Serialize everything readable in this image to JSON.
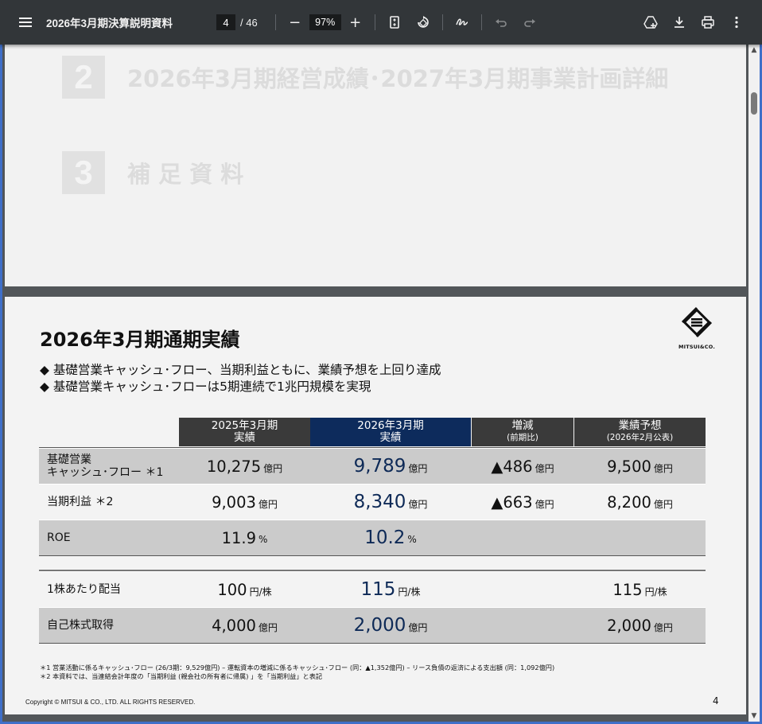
{
  "toolbar": {
    "menu_icon": "hamburger-menu-icon",
    "title": "2026年3月期決算説明資料",
    "current_page": "4",
    "total_pages": "/ 46",
    "zoom_out": "−",
    "zoom_value": "97%",
    "zoom_in": "+",
    "icons": [
      "fit-page-icon",
      "rotate-icon",
      "annotate-icon",
      "undo-icon",
      "redo-icon",
      "save-to-drive-icon",
      "download-icon",
      "print-icon",
      "more-vert-icon"
    ]
  },
  "page1": {
    "toc": [
      {
        "num": "2",
        "text": "2026年3月期経営成績･2027年3月期事業計画詳細"
      },
      {
        "num": "3",
        "text": "補 足 資 料"
      }
    ]
  },
  "page2": {
    "logo_text": "MITSUI&CO.",
    "title": "2026年3月期通期実績",
    "bullets": [
      "基礎営業キャッシュ･フロー、当期利益ともに、業績予想を上回り達成",
      "基礎営業キャッシュ･フローは5期連続で1兆円規模を実現"
    ],
    "table": {
      "headers": [
        {
          "l1": "2025年3月期",
          "l2": "実績",
          "color": "#3a3a3a"
        },
        {
          "l1": "2026年3月期",
          "l2": "実績",
          "color": "#0d2b5c"
        },
        {
          "l1": "増減",
          "l2": "(前期比)",
          "color": "#3a3a3a"
        },
        {
          "l1": "業績予想",
          "l2": "(2026年2月公表)",
          "color": "#3a3a3a"
        }
      ],
      "rows": [
        {
          "label1": "基礎営業",
          "label2": "キャッシュ･フロー ＊1",
          "c1": "10,275",
          "u1": "億円",
          "c2": "9,789",
          "u2": "億円",
          "c3": "▲486",
          "u3": "億円",
          "c4": "9,500",
          "u4": "億円"
        },
        {
          "label1": "当期利益 ＊2",
          "label2": "",
          "c1": "9,003",
          "u1": "億円",
          "c2": "8,340",
          "u2": "億円",
          "c3": "▲663",
          "u3": "億円",
          "c4": "8,200",
          "u4": "億円"
        },
        {
          "label1": "ROE",
          "label2": "",
          "c1": "11.9",
          "u1": "%",
          "c2": "10.2",
          "u2": "%",
          "c3": "",
          "u3": "",
          "c4": "",
          "u4": ""
        },
        {
          "label1": "1株あたり配当",
          "label2": "",
          "c1": "100",
          "u1": "円/株",
          "c2": "115",
          "u2": "円/株",
          "c3": "",
          "u3": "",
          "c4": "115",
          "u4": "円/株"
        },
        {
          "label1": "自己株式取得",
          "label2": "",
          "c1": "4,000",
          "u1": "億円",
          "c2": "2,000",
          "u2": "億円",
          "c3": "",
          "u3": "",
          "c4": "2,000",
          "u4": "億円"
        }
      ]
    },
    "footnotes": [
      "＊1 営業活動に係るキャッシュ･フロー (26/3期：9,529億円) – 運転資本の増減に係るキャッシュ･フロー (同：▲1,352億円) – リース負債の返済による支出額 (同：1,092億円)",
      "＊2 本資料では、当連結会計年度の「当期利益 (親会社の所有者に帰属) 」を「当期利益」と表記"
    ],
    "copyright": "Copyright © MITSUI & CO., LTD. ALL RIGHTS RESERVED.",
    "page_number": "4"
  }
}
